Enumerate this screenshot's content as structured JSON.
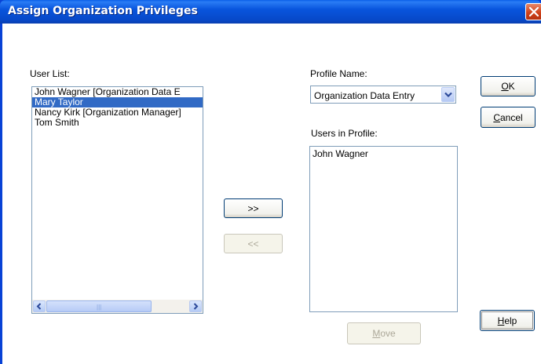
{
  "window": {
    "title": "Assign Organization Privileges",
    "close_label": "Close"
  },
  "user_list": {
    "label": "User List:",
    "items": [
      "John Wagner [Organization Data E",
      "Mary Taylor",
      "Nancy Kirk [Organization Manager]",
      "Tom Smith"
    ],
    "selected_index": 1,
    "scroll_grip": "|||"
  },
  "transfer": {
    "add_label": ">>",
    "remove_label": "<<"
  },
  "profile": {
    "label": "Profile Name:",
    "selected": "Organization Data Entry",
    "users_label": "Users in Profile:",
    "users": [
      "John Wagner"
    ]
  },
  "buttons": {
    "ok_accel": "O",
    "ok_rest": "K",
    "cancel_accel": "C",
    "cancel_rest": "ancel",
    "help_accel": "H",
    "help_rest": "elp",
    "move_accel": "M",
    "move_rest": "ove"
  },
  "colors": {
    "titlebar": "#0a5fe8",
    "selection": "#316ac5",
    "close_button": "#d0421b"
  }
}
